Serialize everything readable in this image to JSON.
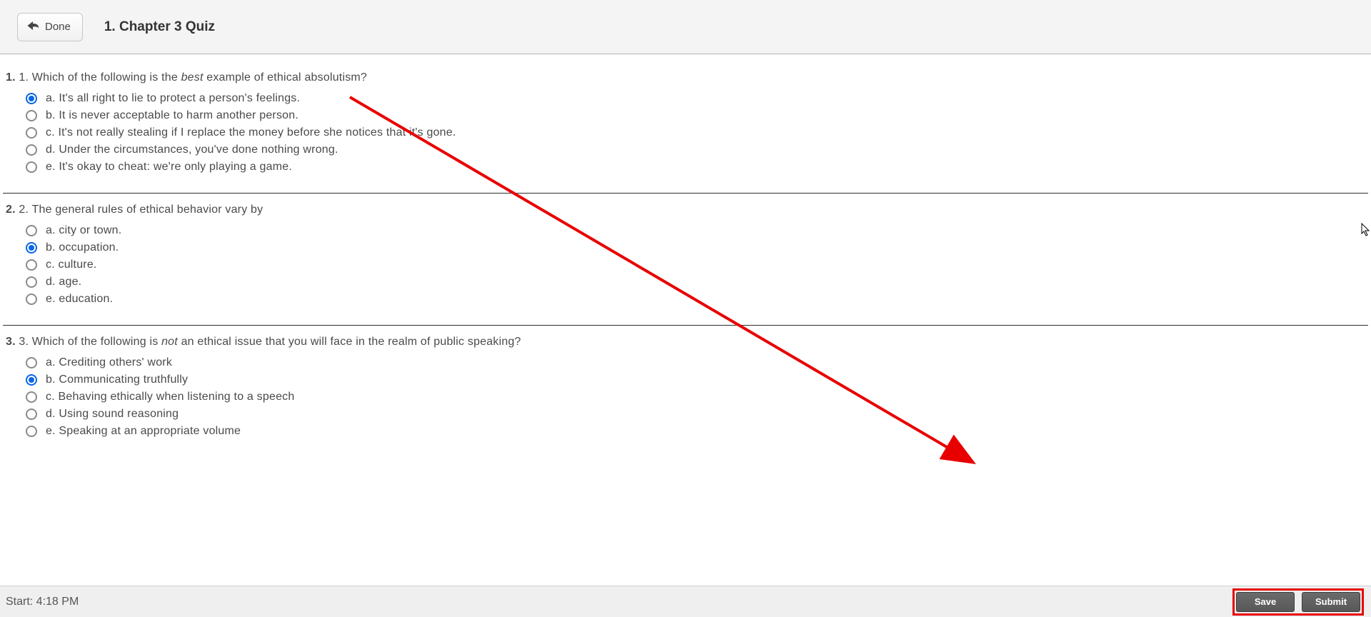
{
  "header": {
    "done_label": "Done",
    "title": "1. Chapter 3 Quiz"
  },
  "questions": [
    {
      "number": "1.",
      "stem_prefix": "1. Which of the following is the ",
      "stem_em": "best",
      "stem_suffix": " example of ethical absolutism?",
      "selected": 0,
      "options": [
        "a. It's all right to lie to protect a person's feelings.",
        "b. It is never acceptable to harm another person.",
        "c. It's not really stealing if I replace the money before she notices that it's gone.",
        "d. Under the circumstances, you've done nothing wrong.",
        "e. It's okay to cheat: we're only playing a game."
      ]
    },
    {
      "number": "2.",
      "stem_prefix": "2. The general rules of ethical behavior vary by",
      "stem_em": "",
      "stem_suffix": "",
      "selected": 1,
      "options": [
        "a. city or town.",
        "b. occupation.",
        "c. culture.",
        "d. age.",
        "e. education."
      ]
    },
    {
      "number": "3.",
      "stem_prefix": "3. Which of the following is ",
      "stem_em": "not",
      "stem_suffix": " an ethical issue that you will face in the realm of public speaking?",
      "selected": 1,
      "options": [
        "a. Crediting others' work",
        "b. Communicating truthfully",
        "c. Behaving ethically when listening to a speech",
        "d. Using sound reasoning",
        "e. Speaking at an appropriate volume"
      ]
    }
  ],
  "footer": {
    "start_label": "Start: 4:18 PM",
    "save_label": "Save",
    "submit_label": "Submit"
  },
  "annotation": {
    "arrow_color": "#e80000"
  }
}
